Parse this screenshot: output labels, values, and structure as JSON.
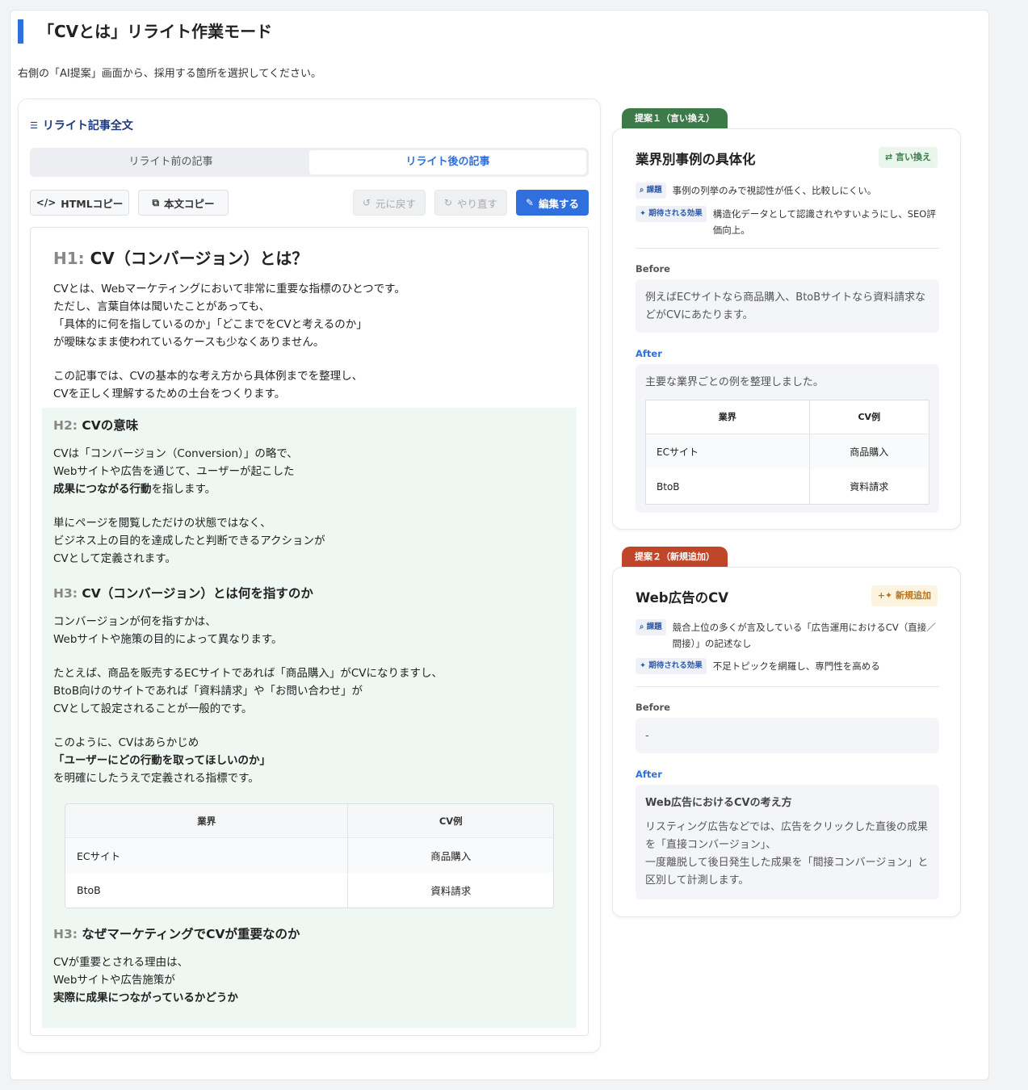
{
  "page": {
    "title": "「CVとは」リライト作業モード",
    "description": "右側の「AI提案」画面から、採用する箇所を選択してください。"
  },
  "left_panel": {
    "heading": "リライト記事全文",
    "tabs": [
      "リライト前の記事",
      "リライト後の記事"
    ],
    "active_tab": "リライト後の記事",
    "buttons": {
      "html_copy": "HTMLコピー",
      "text_copy": "本文コピー",
      "undo": "元に戻す",
      "redo": "やり直す",
      "edit": "編集する"
    }
  },
  "article": {
    "h1_tag": "H1:",
    "h1": "CV（コンバージョン）とは？",
    "intro1": [
      "CVとは、Webマーケティングにおいて非常に重要な指標のひとつです。",
      "ただし、言葉自体は聞いたことがあっても、",
      "「具体的に何を指しているのか」「どこまでをCVと考えるのか」",
      "が曖昧なまま使われているケースも少なくありません。"
    ],
    "intro2": [
      "この記事では、CVの基本的な考え方から具体例までを整理し、",
      "CVを正しく理解するための土台をつくります。"
    ],
    "h2_tag": "H2:",
    "h2": "CVの意味",
    "meaning1": [
      "CVは「コンバージョン（Conversion）」の略で、",
      "Webサイトや広告を通じて、ユーザーが起こした"
    ],
    "meaning1_bold": "成果につながる行動",
    "meaning1_tail": "を指します。",
    "meaning2": [
      "単にページを閲覧しただけの状態ではなく、",
      "ビジネス上の目的を達成したと判断できるアクションが",
      "CVとして定義されます。"
    ],
    "h3a_tag": "H3:",
    "h3a": "CV（コンバージョン）とは何を指すのか",
    "what1": [
      "コンバージョンが何を指すかは、",
      "Webサイトや施策の目的によって異なります。"
    ],
    "what2": [
      "たとえば、商品を販売するECサイトであれば「商品購入」がCVになりますし、",
      "BtoB向けのサイトであれば「資料請求」や「お問い合わせ」が",
      "CVとして設定されることが一般的です。"
    ],
    "what3_l1": "このように、CVはあらかじめ",
    "what3_bold": "「ユーザーにどの行動を取ってほしいのか」",
    "what3_l3": "を明確にしたうえで定義される指標です。",
    "table": {
      "headers": [
        "業界",
        "CV例"
      ],
      "rows": [
        [
          "ECサイト",
          "商品購入"
        ],
        [
          "BtoB",
          "資料請求"
        ]
      ]
    },
    "h3b_tag": "H3:",
    "h3b": "なぜマーケティングでCVが重要なのか",
    "why_l1": "CVが重要とされる理由は、",
    "why_l2": "Webサイトや広告施策が",
    "why_bold": "実際に成果につながっているかどうか"
  },
  "proposals": [
    {
      "badge": "提案１（言い換え）",
      "title": "業界別事例の具体化",
      "type_label": "言い換え",
      "issue_label": "課題",
      "issue": "事例の列挙のみで視認性が低く、比較しにくい。",
      "effect_label": "期待される効果",
      "effect": "構造化データとして認識されやすいようにし、SEO評価向上。",
      "before_label": "Before",
      "before": "例えばECサイトなら商品購入、BtoBサイトなら資料請求などがCVにあたります。",
      "after_label": "After",
      "after_text": "主要な業界ごとの例を整理しました。",
      "after_table": {
        "headers": [
          "業界",
          "CV例"
        ],
        "rows": [
          [
            "ECサイト",
            "商品購入"
          ],
          [
            "BtoB",
            "資料請求"
          ]
        ]
      }
    },
    {
      "badge": "提案２（新規追加）",
      "title": "Web広告のCV",
      "type_label": "新規追加",
      "issue_label": "課題",
      "issue": "競合上位の多くが言及している「広告運用におけるCV（直接／間接）」の記述なし",
      "effect_label": "期待される効果",
      "effect": "不足トピックを網羅し、専門性を高める",
      "before_label": "Before",
      "before": "-",
      "after_label": "After",
      "after_title": "Web広告におけるCVの考え方",
      "after_lines": [
        "リスティング広告などでは、広告をクリックした直後の成果を「直接コンバージョン」、",
        "一度離脱して後日発生した成果を「間接コンバージョン」と区別して計測します。"
      ]
    }
  ],
  "colors": {
    "accent": "#2f6fde",
    "badge1": "#3c7a4a",
    "badge2": "#c0462a",
    "highlight": "#eef7f1"
  }
}
